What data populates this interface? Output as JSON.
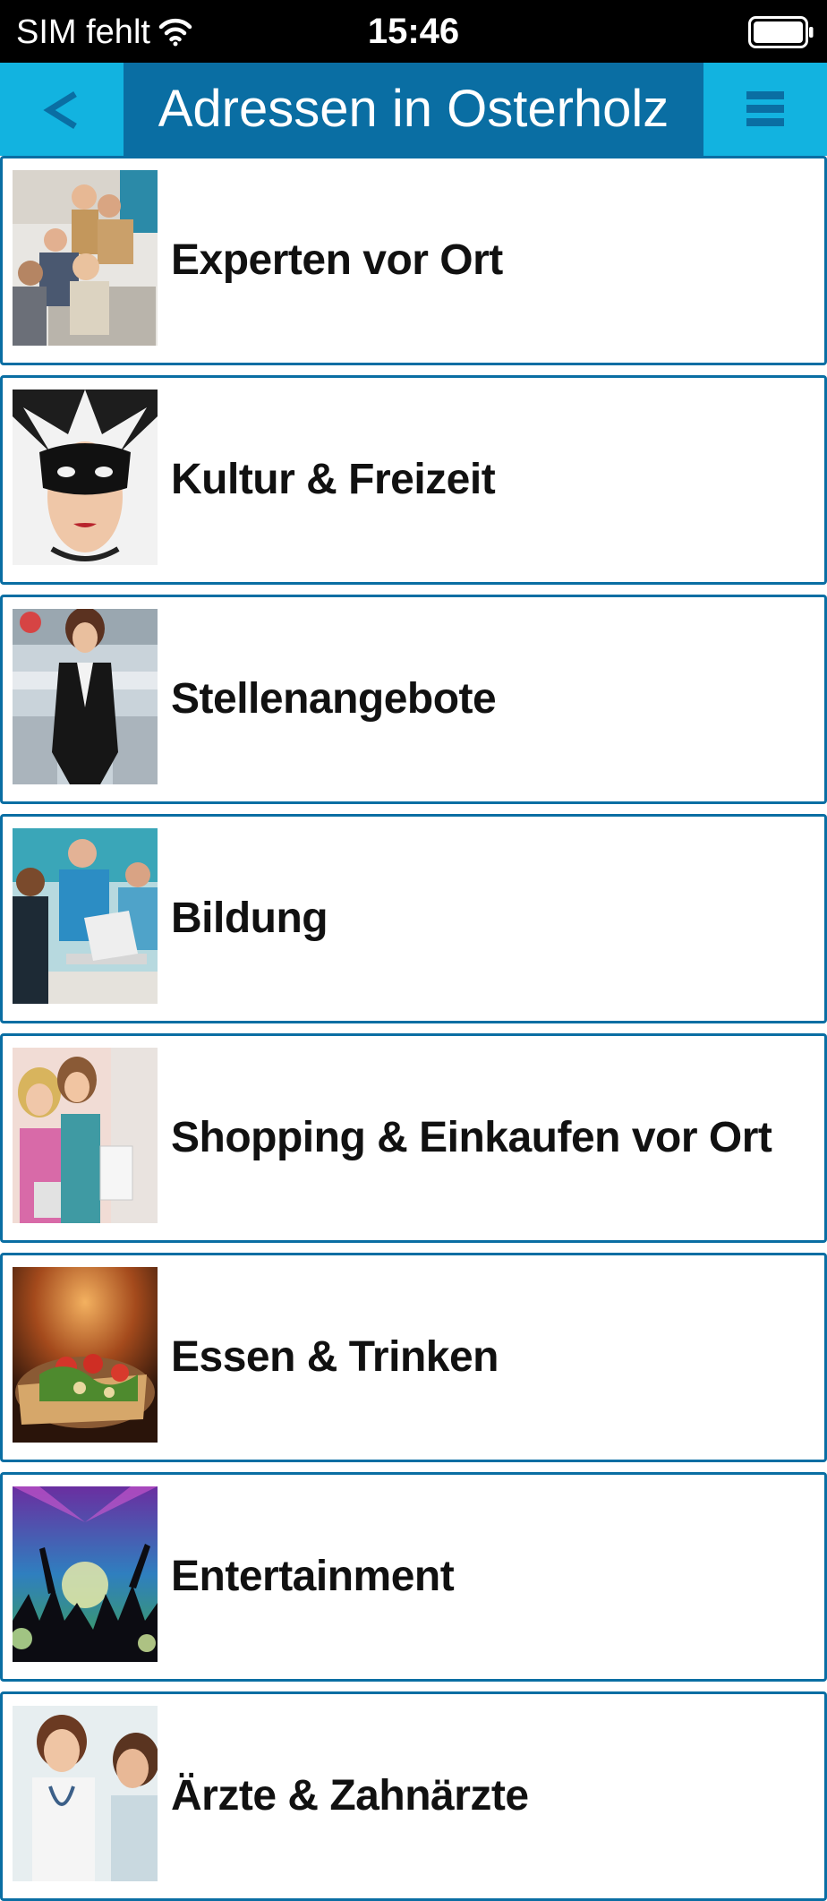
{
  "status_bar": {
    "carrier": "SIM fehlt",
    "time": "15:46",
    "icons": [
      "wifi-icon",
      "battery-icon"
    ]
  },
  "nav": {
    "back_label": "<",
    "title": "Adressen in Osterholz",
    "menu_icon": "hamburger-menu-icon"
  },
  "colors": {
    "nav_dark": "#0a6ea3",
    "nav_light": "#12b3e0",
    "item_border": "#0a6ea3"
  },
  "items": [
    {
      "label": "Experten vor Ort",
      "image": "business-meeting-photo"
    },
    {
      "label": "Kultur & Freizeit",
      "image": "masquerade-mask-photo"
    },
    {
      "label": "Stellenangebote",
      "image": "businesswoman-photo"
    },
    {
      "label": "Bildung",
      "image": "classroom-laptop-photo"
    },
    {
      "label": "Shopping & Einkaufen vor Ort",
      "image": "shopping-friends-photo"
    },
    {
      "label": "Essen & Trinken",
      "image": "pizza-photo"
    },
    {
      "label": "Entertainment",
      "image": "concert-crowd-photo"
    },
    {
      "label": "Ärzte & Zahnärzte",
      "image": "doctor-patient-photo"
    }
  ]
}
